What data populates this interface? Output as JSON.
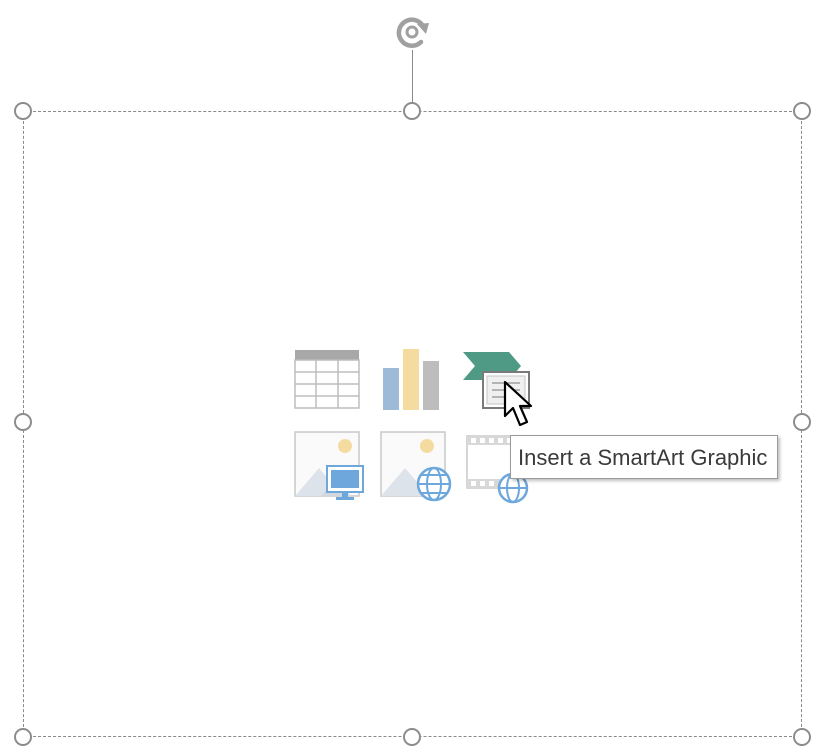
{
  "tooltip": {
    "text": "Insert a SmartArt Graphic"
  },
  "content_placeholder": {
    "icons": [
      "table-icon",
      "chart-icon",
      "smartart-icon",
      "pictures-icon",
      "online-pictures-icon",
      "video-icon"
    ]
  },
  "colors": {
    "handle": "#8c8c8c",
    "border": "#8a8a8a",
    "smartart_green": "#4f9a85",
    "chart_blue": "#9dbbd8",
    "chart_yellow": "#f4dca0",
    "chart_gray": "#bdbdbd",
    "monitor_blue": "#6ea7dc"
  }
}
